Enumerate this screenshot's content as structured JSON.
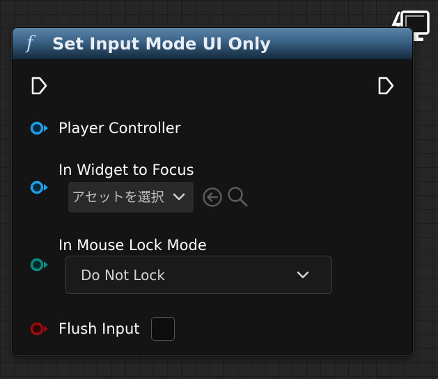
{
  "node": {
    "title": "Set Input Mode UI Only",
    "function_icon": "f",
    "pins": {
      "player_controller": "Player Controller",
      "widget_to_focus": "In Widget to Focus",
      "mouse_lock_mode": "In Mouse Lock Mode",
      "flush_input": "Flush Input"
    },
    "asset_picker": {
      "value": "アセットを選択"
    },
    "mouse_lock_dropdown": {
      "selected": "Do Not Lock"
    },
    "flush_input_checked": false
  },
  "colors": {
    "header_top": "#5a84a8",
    "header_bottom": "#152a3d",
    "object_pin": "#1ea0e8",
    "enum_pin": "#0a8a82",
    "bool_pin": "#9c0c0c",
    "exec_pin": "#ffffff"
  },
  "icons": {
    "execution_in": "exec-in-pin-icon",
    "execution_out": "exec-out-pin-icon",
    "use_selected": "arrow-left-circle-icon",
    "browse": "search-icon",
    "remote_monitor": "remote-monitor-icon"
  }
}
